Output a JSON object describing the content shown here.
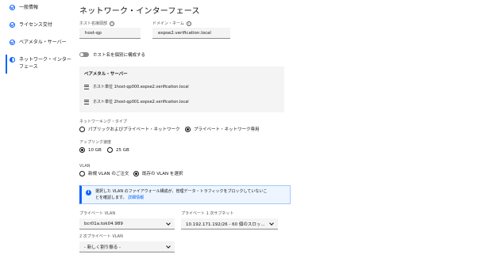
{
  "sidebar": {
    "steps": [
      {
        "label": "一般情報",
        "state": "done"
      },
      {
        "label": "ライセンス交付",
        "state": "done"
      },
      {
        "label": "ベアメタル・サーバー",
        "state": "done"
      },
      {
        "label_line1": "ネットワーク・インター",
        "label_line2": "フェース",
        "state": "current"
      }
    ]
  },
  "page": {
    "title": "ネットワーク・インターフェース"
  },
  "host": {
    "label": "ホスト名接頭部",
    "value": "host-qp"
  },
  "domain": {
    "label": "ドメイン・ネーム",
    "value": "expse2.verification.local"
  },
  "toggle": {
    "label": "ホスト名を個別に構成する",
    "on": false
  },
  "bare_metal": {
    "title": "ベアメタル・サーバー",
    "rows": [
      "ホスト単位 1host-qp000.expse2.verification.local",
      "ホスト単位 2host-qp001.expse2.verification.local"
    ]
  },
  "networking_type": {
    "label": "ネットワーキング・タイプ",
    "options": [
      {
        "label": "パブリックおよびプライベート・ネットワーク",
        "selected": false
      },
      {
        "label": "プライベート・ネットワーク専用",
        "selected": true
      }
    ]
  },
  "uplink": {
    "label": "アップリンク速度",
    "options": [
      {
        "label": "10 GB",
        "selected": true
      },
      {
        "label": "25 GB",
        "selected": false
      }
    ]
  },
  "vlan": {
    "label": "VLAN",
    "options": [
      {
        "label": "新規 VLAN のご注文",
        "selected": false
      },
      {
        "label": "既存の VLAN を選択",
        "selected": true
      }
    ]
  },
  "notice": {
    "line1": "選択した VLAN のファイアウォール構成が、管理データ・トラフィックをブロックしていないこ",
    "line2": "とを確認します。",
    "link": "詳細情報"
  },
  "private_vlan": {
    "label": "プライベート VLAN",
    "value": "bcr01a.tok04.989"
  },
  "private_subnet": {
    "label": "プライベート 1 次サブネット",
    "value": "10.192.171.192/26 - 60 個のスロッ..."
  },
  "secondary_private_vlan": {
    "label": "2 次プライベート VLAN",
    "value": "- 新しく割り振る -"
  },
  "colors": {
    "accent": "#0f62fe",
    "field_bg": "#f4f4f4",
    "notice_bg": "#edf5ff"
  }
}
